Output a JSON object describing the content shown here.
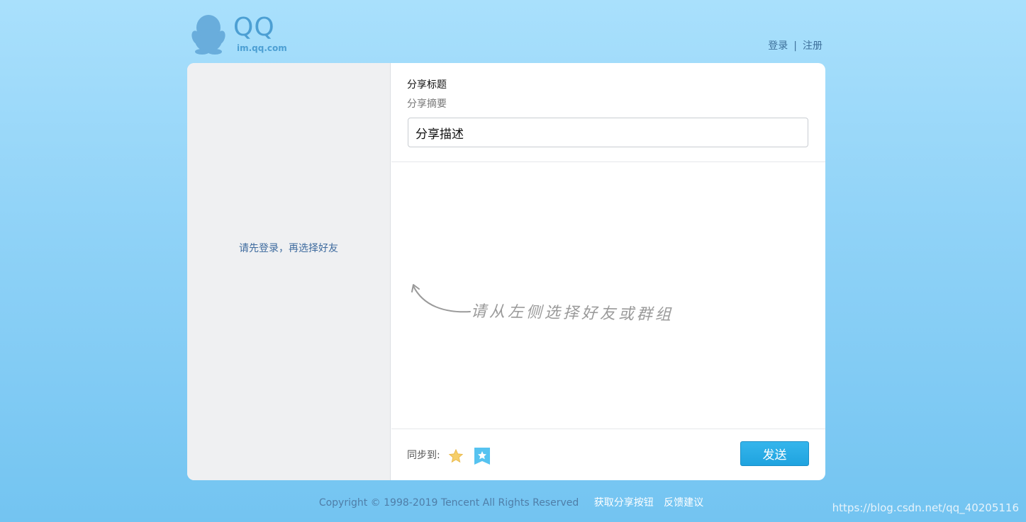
{
  "header": {
    "logo_text": "QQ",
    "logo_domain": "im.qq.com",
    "login_label": "登录",
    "separator": "|",
    "register_label": "注册"
  },
  "left": {
    "hint": "请先登录，再选择好友"
  },
  "share": {
    "title": "分享标题",
    "summary": "分享摘要",
    "description_value": "分享描述",
    "select_hint": "请从左侧选择好友或群组"
  },
  "footer": {
    "sync_label": "同步到:",
    "sync_icons": [
      "star-icon",
      "qzone-badge-icon"
    ],
    "send_label": "发送",
    "copyright": "Copyright © 1998-2019 Tencent All Rights Reserved",
    "get_button_link": "获取分享按钮",
    "feedback_link": "反馈建议",
    "watermark": "https://blog.csdn.net/qq_40205116"
  },
  "colors": {
    "brand_blue": "#4c9fd3",
    "send_button": "#25a9e4",
    "link_blue": "#3d6f9a"
  }
}
